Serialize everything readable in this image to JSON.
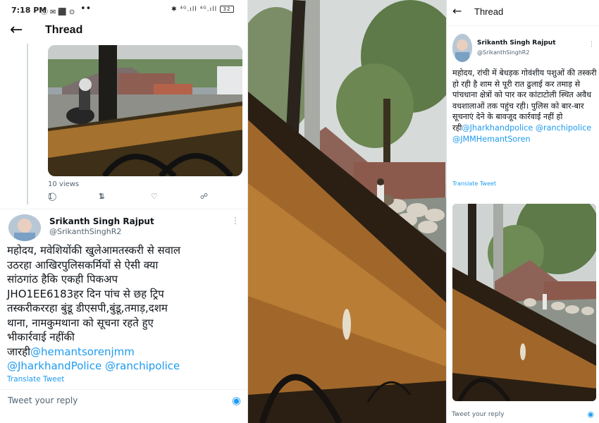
{
  "left": {
    "status": {
      "time": "7:18 PM",
      "left_icons": "⓪✉⬛⊙",
      "more_dots": "••",
      "right_icons": "✱ ⁴ᴳ.ıll ⁴ᴳ.ıll",
      "battery": "32"
    },
    "header": {
      "back_icon": "arrow-left-icon",
      "title": "Thread"
    },
    "views": "10 views",
    "actions": {
      "reply_count": "1",
      "retweet_count": "1"
    },
    "author": {
      "name": "Srikanth Singh Rajput",
      "handle": "@SrikanthSinghR2"
    },
    "body_lines": [
      "महोदय, मवेशियोंकी खुलेआमतस्करी से सवाल",
      "उठरहा आखिरपुलिसकर्मियों से ऐसी क्या",
      "सांठगांठ हैकि एकही पिकअप",
      "JHO1EE6183हर दिन पांच से छह ट्रिप",
      "तस्करीकररहा बुंडू डीएसपी,बुंडू,तमाड़,दशम",
      "थाना, नामकुमथाना को सूचना रहते हुए",
      "भीकार्रवाई नहींकी"
    ],
    "body_last_prefix": "जारही",
    "mentions_1": "@hemantsorenjmm",
    "mentions_2a": "@JharkhandPolice",
    "mentions_2b": "@ranchipolice",
    "translate": "Translate Tweet",
    "reply_placeholder": "Tweet your reply"
  },
  "right": {
    "header": {
      "back_icon": "arrow-left-icon",
      "title": "Thread"
    },
    "author": {
      "name": "Srikanth Singh Rajput",
      "handle": "@SrikanthSinghR2"
    },
    "body": "महोदय, रांची में बेधड़क गोवंशीय पशुओं की तस्करी हो रही है शाम से पूरी रात ढुलाई कर तमाड़ से पांचधाना क्षेत्रों को पार कर कांटाटोली स्थित अवैध वधशालाओं तक पहुंच रही। पुलिस को बार-बार सूचनाएं देने के बावजूद कार्रवाई नहीं हो रही",
    "mention_1": "@Jharkhandpolice",
    "mention_2": "@ranchipolice",
    "mention_3": "@JMMHemantSoren",
    "translate": "Translate Tweet",
    "reply_placeholder": "Tweet your reply"
  },
  "colors": {
    "link": "#1d9bf0",
    "muted": "#536471",
    "text": "#0f1419"
  }
}
